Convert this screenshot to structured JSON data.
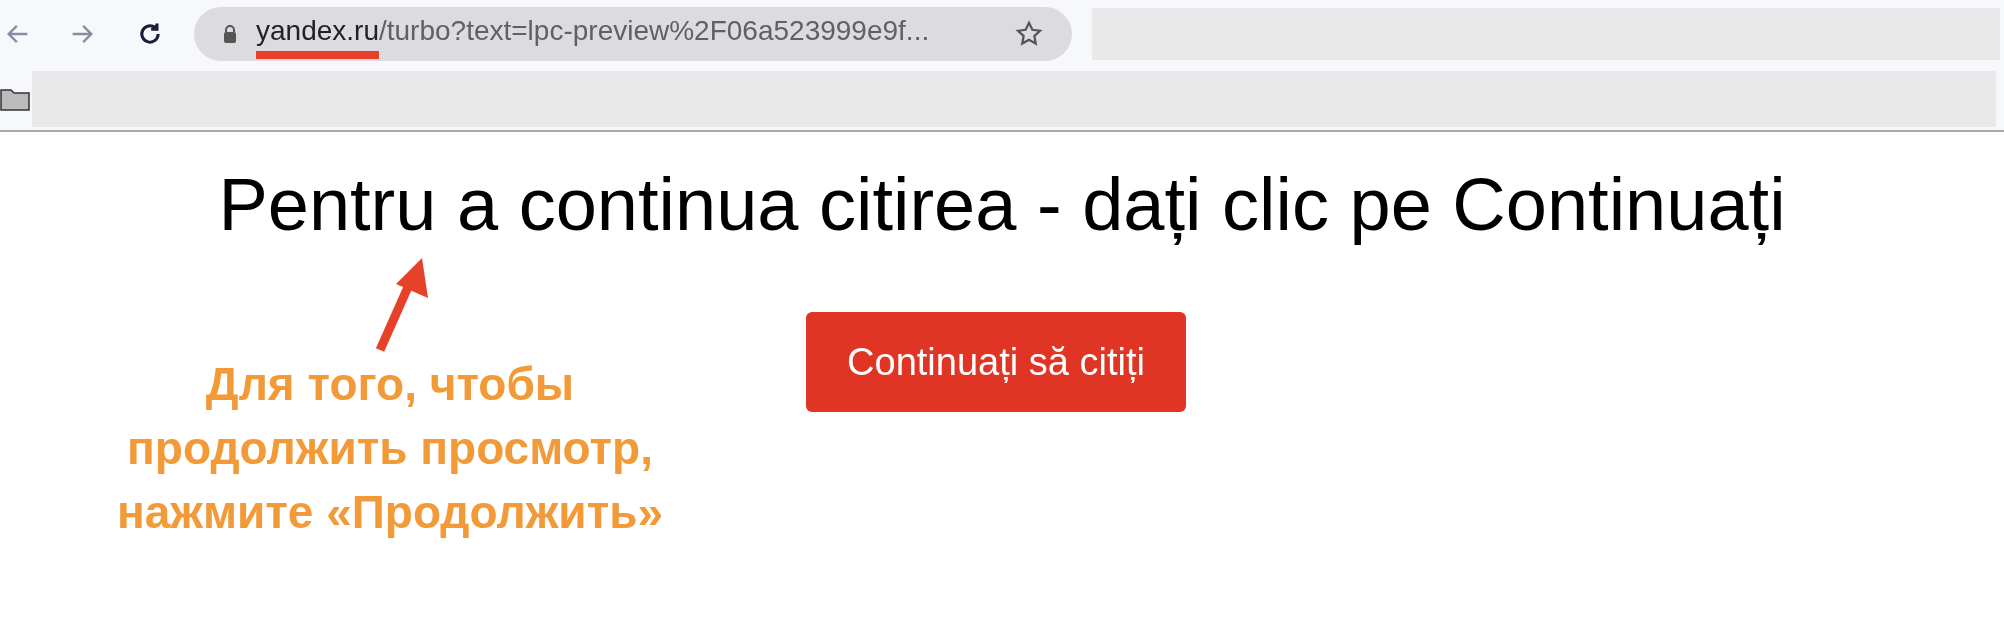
{
  "browser": {
    "address_bar": {
      "domain": "yandex.ru",
      "path": "/turbo?text=lpc-preview%2F06a523999e9f...",
      "domain_underlined": true,
      "bookmarked": false
    }
  },
  "page": {
    "heading": "Pentru a continua citirea - dați clic pe Continuați",
    "button": "Continuați să citiți"
  },
  "annotation": {
    "lines": [
      "Для того, чтобы",
      "продолжить просмотр,",
      "нажмите «Продолжить»"
    ]
  }
}
